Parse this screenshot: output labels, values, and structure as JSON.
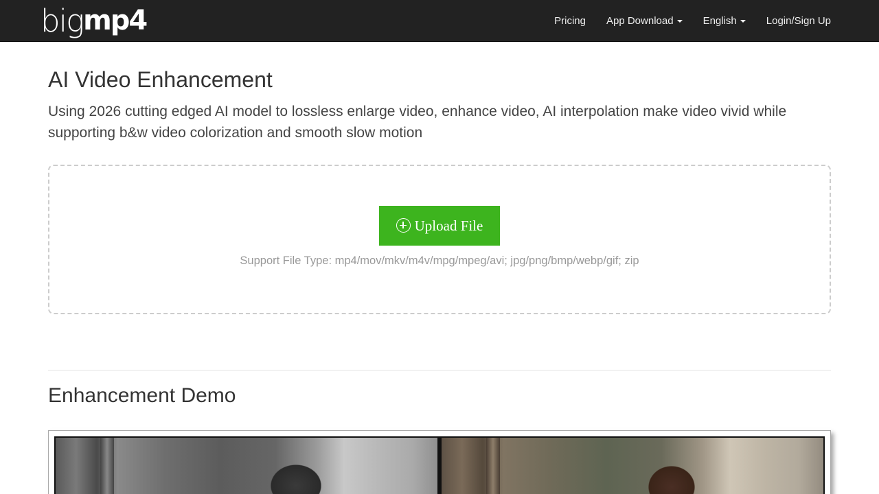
{
  "nav": {
    "logo_light": "big",
    "logo_bold": "mp4",
    "pricing": "Pricing",
    "app_download": "App Download",
    "language": "English",
    "login": "Login/Sign Up"
  },
  "hero": {
    "title": "AI Video Enhancement",
    "description": "Using 2026 cutting edged AI model to lossless enlarge video, enhance video, AI interpolation make video vivid while supporting b&w video colorization and smooth slow motion"
  },
  "upload": {
    "button_label": "Upload File",
    "support_text": "Support File Type: mp4/mov/mkv/m4v/mpg/mpeg/avi; jpg/png/bmp/webp/gif; zip"
  },
  "demo": {
    "title": "Enhancement Demo"
  },
  "colors": {
    "navbar_bg": "#222222",
    "upload_button": "#3db41e",
    "dashed_border": "#cccccc"
  },
  "icons": {
    "upload": "plus-circle-icon",
    "dropdown": "caret-down-icon"
  }
}
